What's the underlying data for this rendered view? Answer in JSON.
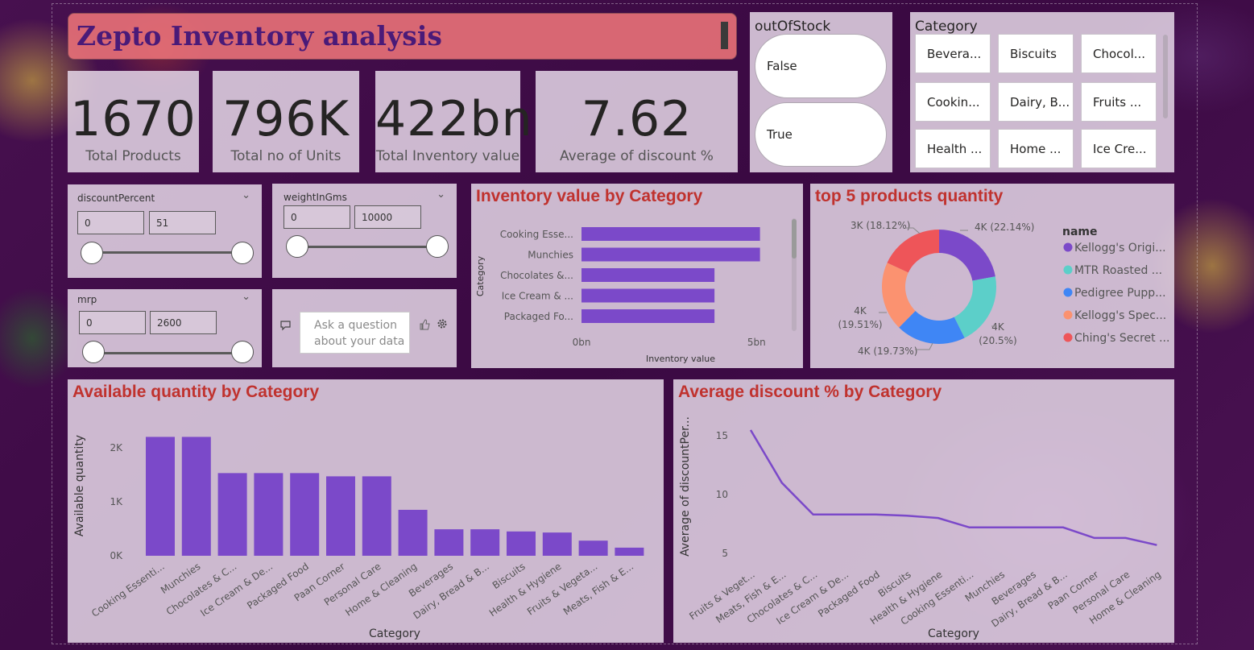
{
  "title": "Zepto Inventory analysis",
  "kpis": [
    {
      "value": "1670",
      "label": "Total Products"
    },
    {
      "value": "796K",
      "label": "Total no of Units"
    },
    {
      "value": "422bn",
      "label": "Total Inventory value"
    },
    {
      "value": "7.62",
      "label": "Average of discount %"
    }
  ],
  "out_of_stock": {
    "title": "outOfStock",
    "options": [
      "False",
      "True"
    ]
  },
  "category_slicer": {
    "title": "Category",
    "tiles": [
      "Bevera...",
      "Biscuits",
      "Chocol...",
      "Cookin...",
      "Dairy, B...",
      "Fruits ...",
      "Health ...",
      "Home ...",
      "Ice Cre..."
    ]
  },
  "filters": {
    "discount": {
      "name": "discountPercent",
      "min": "0",
      "max": "51"
    },
    "weight": {
      "name": "weightInGms",
      "min": "0",
      "max": "10000"
    },
    "mrp": {
      "name": "mrp",
      "min": "0",
      "max": "2600"
    }
  },
  "qa": {
    "placeholder_line1": "Ask a question",
    "placeholder_line2": "about your data"
  },
  "colors": {
    "primary": "#7b49c9",
    "title_red": "#c0322e",
    "title_bar": "#e97178"
  },
  "icons": [
    "chevron-down-icon",
    "chat-icon",
    "thumbs-up-icon",
    "gear-icon"
  ],
  "chart_data": [
    {
      "type": "bar",
      "orientation": "horizontal",
      "title": "Inventory value by Category",
      "xlabel": "Inventory value",
      "ylabel": "Category",
      "categories": [
        "Cooking Esse...",
        "Munchies",
        "Chocolates &...",
        "Ice Cream & ...",
        "Packaged Fo..."
      ],
      "values": [
        5.1,
        5.1,
        3.8,
        3.8,
        3.8
      ],
      "x_ticks": [
        "0bn",
        "5bn"
      ],
      "xlim": [
        0,
        5.5
      ],
      "scrollable": true
    },
    {
      "type": "pie",
      "donut": true,
      "title": "top 5 products quantity",
      "legend_title": "name",
      "legend_position": "right",
      "slices": [
        {
          "name": "Kellogg's Origi...",
          "label": "4K (22.14%)",
          "percent": 22.14,
          "color": "#7b49c9"
        },
        {
          "name": "MTR Roasted ...",
          "label": "4K (20.5%)",
          "percent": 20.5,
          "color": "#5ccfc9"
        },
        {
          "name": "Pedigree Pupp...",
          "label": "4K (19.73%)",
          "percent": 19.73,
          "color": "#3f86f5"
        },
        {
          "name": "Kellogg's Spec...",
          "label": "4K (19.51%)",
          "percent": 19.51,
          "color": "#fb9270"
        },
        {
          "name": "Ching's Secret ...",
          "label": "3K (18.12%)",
          "percent": 18.12,
          "color": "#ee5559"
        }
      ]
    },
    {
      "type": "bar",
      "title": "Available quantity by Category",
      "xlabel": "Category",
      "ylabel": "Available quantity",
      "categories": [
        "Cooking Essenti...",
        "Munchies",
        "Chocolates & C...",
        "Ice Cream & De...",
        "Packaged Food",
        "Paan Corner",
        "Personal Care",
        "Home & Cleaning",
        "Beverages",
        "Dairy, Bread & B...",
        "Biscuits",
        "Health & Hygiene",
        "Fruits & Vegeta...",
        "Meats, Fish & E..."
      ],
      "values": [
        2200,
        2200,
        1530,
        1530,
        1530,
        1470,
        1470,
        850,
        490,
        490,
        450,
        430,
        280,
        150
      ],
      "y_ticks": [
        "0K",
        "1K",
        "2K"
      ],
      "ylim": [
        0,
        2400
      ]
    },
    {
      "type": "line",
      "title": "Average discount % by Category",
      "xlabel": "Category",
      "ylabel": "Average of discountPer...",
      "categories": [
        "Fruits & Veget...",
        "Meats, Fish & E...",
        "Chocolates & C...",
        "Ice Cream & De...",
        "Packaged Food",
        "Biscuits",
        "Health & Hygiene",
        "Cooking Essenti...",
        "Munchies",
        "Beverages",
        "Dairy, Bread & B...",
        "Paan Corner",
        "Personal Care",
        "Home & Cleaning"
      ],
      "values": [
        15.5,
        11.0,
        8.3,
        8.3,
        8.3,
        8.2,
        8.0,
        7.2,
        7.2,
        7.2,
        7.2,
        6.3,
        6.3,
        5.7
      ],
      "y_ticks": [
        5,
        10,
        15
      ],
      "ylim": [
        3,
        17
      ]
    }
  ]
}
